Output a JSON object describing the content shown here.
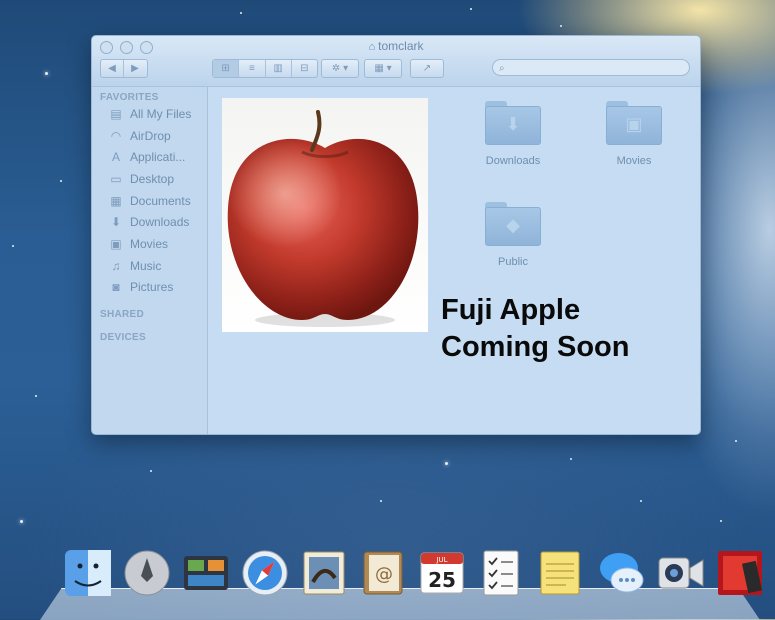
{
  "window": {
    "title": "tomclark",
    "toolbar": {
      "back_forward": [
        "◀",
        "▶"
      ],
      "view_modes": [
        "⊞",
        "≡",
        "▥",
        "⊟"
      ],
      "action": "✲ ▾",
      "arrange": "▦ ▾",
      "share": "↗",
      "search_placeholder": ""
    }
  },
  "sidebar": {
    "sections": [
      {
        "title": "FAVORITES",
        "items": [
          {
            "label": "All My Files",
            "icon": "files-icon"
          },
          {
            "label": "AirDrop",
            "icon": "airdrop-icon"
          },
          {
            "label": "Applicati...",
            "icon": "applications-icon"
          },
          {
            "label": "Desktop",
            "icon": "desktop-icon"
          },
          {
            "label": "Documents",
            "icon": "documents-icon"
          },
          {
            "label": "Downloads",
            "icon": "downloads-icon"
          },
          {
            "label": "Movies",
            "icon": "movies-icon"
          },
          {
            "label": "Music",
            "icon": "music-icon"
          },
          {
            "label": "Pictures",
            "icon": "pictures-icon"
          }
        ]
      },
      {
        "title": "SHARED",
        "items": []
      },
      {
        "title": "DEVICES",
        "items": []
      }
    ]
  },
  "folders": [
    {
      "label": "Downloads",
      "icon": "downloads-folder-icon"
    },
    {
      "label": "Movies",
      "icon": "movies-folder-icon"
    },
    {
      "label": "Public",
      "icon": "public-folder-icon"
    }
  ],
  "overlay": {
    "line1": "Fuji Apple",
    "line2": "Coming Soon"
  },
  "dock": {
    "calendar_day": "25",
    "calendar_month": "JUL",
    "items": [
      "finder-icon",
      "launchpad-icon",
      "mission-control-icon",
      "safari-icon",
      "mail-icon",
      "contacts-icon",
      "calendar-icon",
      "reminders-icon",
      "notes-icon",
      "messages-icon",
      "facetime-icon",
      "photo-booth-icon"
    ]
  },
  "colors": {
    "window_bg": "#c5dcf2",
    "sidebar_bg": "#c1d8ee",
    "text_muted": "#6f8fb0",
    "caption": "#0a0a0a"
  }
}
